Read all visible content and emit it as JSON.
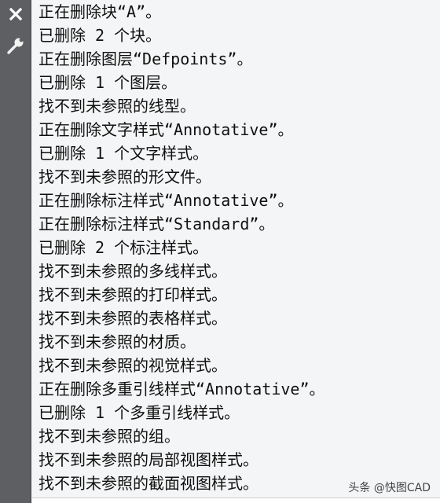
{
  "sidebar": {
    "close_icon": "close-icon",
    "settings_icon": "wrench-icon"
  },
  "history": [
    "正在删除块“A”。",
    "已删除 2 个块。",
    "正在删除图层“Defpoints”。",
    "已删除 1 个图层。",
    "找不到未参照的线型。",
    "正在删除文字样式“Annotative”。",
    "已删除 1 个文字样式。",
    "找不到未参照的形文件。",
    "正在删除标注样式“Annotative”。",
    "正在删除标注样式“Standard”。",
    "已删除 2 个标注样式。",
    "找不到未参照的多线样式。",
    "找不到未参照的打印样式。",
    "找不到未参照的表格样式。",
    "找不到未参照的材质。",
    "找不到未参照的视觉样式。",
    "正在删除多重引线样式“Annotative”。",
    "已删除 1 个多重引线样式。",
    "找不到未参照的组。",
    "找不到未参照的局部视图样式。",
    "找不到未参照的截面视图样式。"
  ],
  "watermark": "头条 @快图CAD"
}
